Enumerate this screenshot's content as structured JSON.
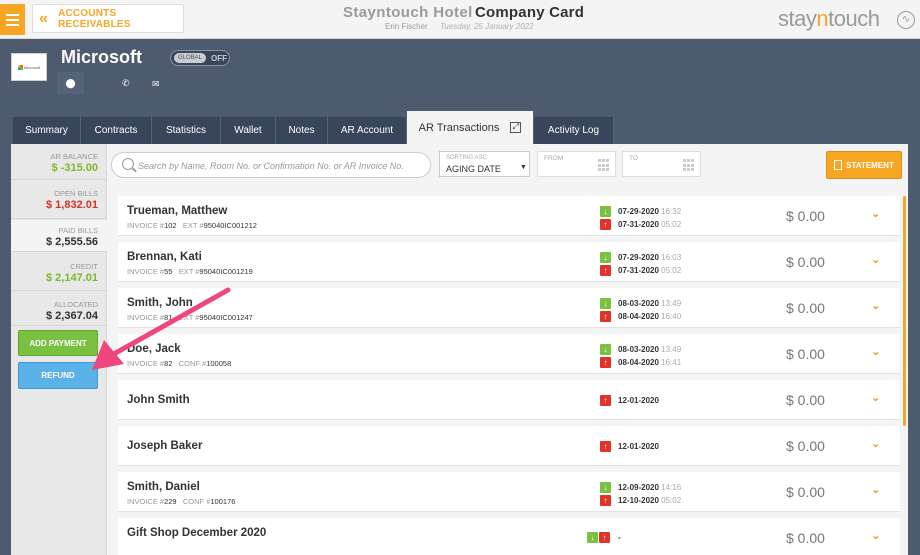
{
  "header": {
    "back_label": "ACCOUNTS RECEIVABLES",
    "hotel": "Stayntouch Hotel",
    "title": "Company Card",
    "user": "Erin Fischer",
    "date": "Tuesday, 25 January 2022",
    "logo_a": "stay",
    "logo_b": "n",
    "logo_c": "touch"
  },
  "company": {
    "name": "Microsoft",
    "logo_text": "Microsoft",
    "global_label": "GLOBAL",
    "global_state": "OFF"
  },
  "tabs": [
    {
      "label": "Summary"
    },
    {
      "label": "Contracts"
    },
    {
      "label": "Statistics"
    },
    {
      "label": "Wallet"
    },
    {
      "label": "Notes"
    },
    {
      "label": "AR Account"
    },
    {
      "label": "AR Transactions"
    },
    {
      "label": "Activity Log"
    }
  ],
  "sidebar": {
    "ar_balance_label": "AR BALANCE",
    "ar_balance": "$ -315.00",
    "open_bills_label": "OPEN BILLS",
    "open_bills": "$ 1,832.01",
    "paid_bills_label": "PAID BILLS",
    "paid_bills": "$ 2,555.56",
    "credit_label": "CREDIT",
    "credit": "$ 2,147.01",
    "allocated_label": "ALLOCATED",
    "allocated": "$ 2,367.04",
    "add_payment": "ADD PAYMENT",
    "refund": "REFUND"
  },
  "filters": {
    "search_placeholder": "Search by Name, Room No. or Confirmation No. or AR Invoice No.",
    "sort_label": "SORTING ASC",
    "sort_value": "AGING DATE",
    "from_label": "FROM",
    "to_label": "TO",
    "statement": "STATEMENT"
  },
  "transactions": [
    {
      "name": "Trueman, Matthew",
      "ref_label": "INVOICE #",
      "ref": "102",
      "ext_label": "EXT #",
      "ext": "95040IC001212",
      "in_date": "07-29-2020",
      "in_time": "16:32",
      "out_date": "07-31-2020",
      "out_time": "05:02",
      "amount": "$ 0.00"
    },
    {
      "name": "Brennan, Kati",
      "ref_label": "INVOICE #",
      "ref": "55",
      "ext_label": "EXT #",
      "ext": "95040IC001219",
      "in_date": "07-29-2020",
      "in_time": "16:03",
      "out_date": "07-31-2020",
      "out_time": "05:02",
      "amount": "$ 0.00"
    },
    {
      "name": "Smith, John",
      "ref_label": "INVOICE #",
      "ref": "81",
      "ext_label": "EXT #",
      "ext": "95040IC001247",
      "in_date": "08-03-2020",
      "in_time": "13:49",
      "out_date": "08-04-2020",
      "out_time": "16:40",
      "amount": "$ 0.00"
    },
    {
      "name": "Doe, Jack",
      "ref_label": "INVOICE #",
      "ref": "82",
      "ext_label": "CONF #",
      "ext": "100058",
      "in_date": "08-03-2020",
      "in_time": "13:49",
      "out_date": "08-04-2020",
      "out_time": "16:41",
      "amount": "$ 0.00"
    },
    {
      "name": "John Smith",
      "out_date": "12-01-2020",
      "amount": "$ 0.00"
    },
    {
      "name": "Joseph Baker",
      "out_date": "12-01-2020",
      "amount": "$ 0.00"
    },
    {
      "name": "Smith, Daniel",
      "ref_label": "INVOICE #",
      "ref": "229",
      "ext_label": "CONF #",
      "ext": "100176",
      "in_date": "12-09-2020",
      "in_time": "14:16",
      "out_date": "12-10-2020",
      "out_time": "05:02",
      "amount": "$ 0.00"
    },
    {
      "name": "Gift Shop December 2020",
      "dash": "-",
      "amount": "$ 0.00"
    }
  ],
  "colors": {
    "accent": "#f6a623",
    "navy": "#4e5a6e",
    "green": "#7ac142",
    "red": "#e0342a",
    "blue": "#5bb2e8",
    "callout": "#f0467f"
  }
}
